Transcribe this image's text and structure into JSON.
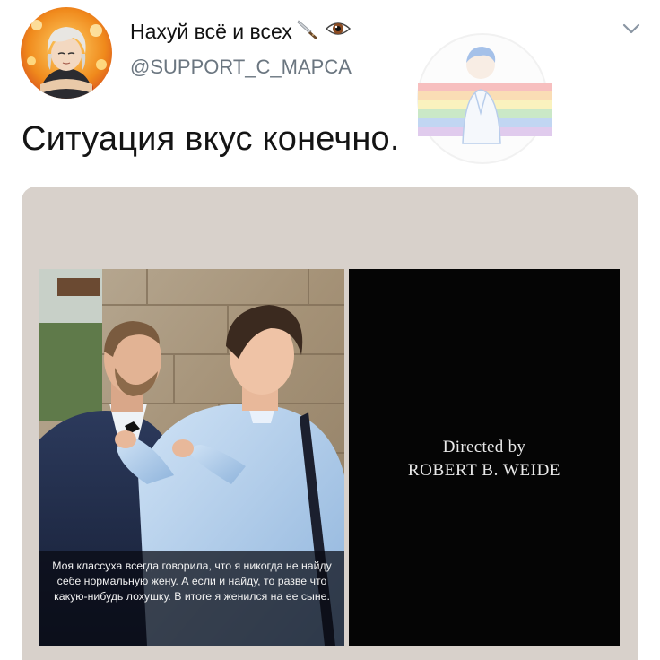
{
  "tweet": {
    "display_name": "Нахуй всё и всех",
    "name_emojis": [
      "knife-icon",
      "eye-icon"
    ],
    "handle": "@SUPPORT_C_MAPCA",
    "text": "Ситуация вкус конечно."
  },
  "media": {
    "caption": "Моя классуха всегда говорила, что я никогда не найду себе нормальную жену. А если и найду, то разве что какую-нибудь лохушку. В итоге я женился на ее сыне.",
    "credits_line1": "Directed by",
    "credits_line2": "ROBERT B. WEIDE"
  },
  "colors": {
    "card_background": "#d8d1cb",
    "handle_gray": "#6b7680",
    "black_panel": "#050505"
  }
}
